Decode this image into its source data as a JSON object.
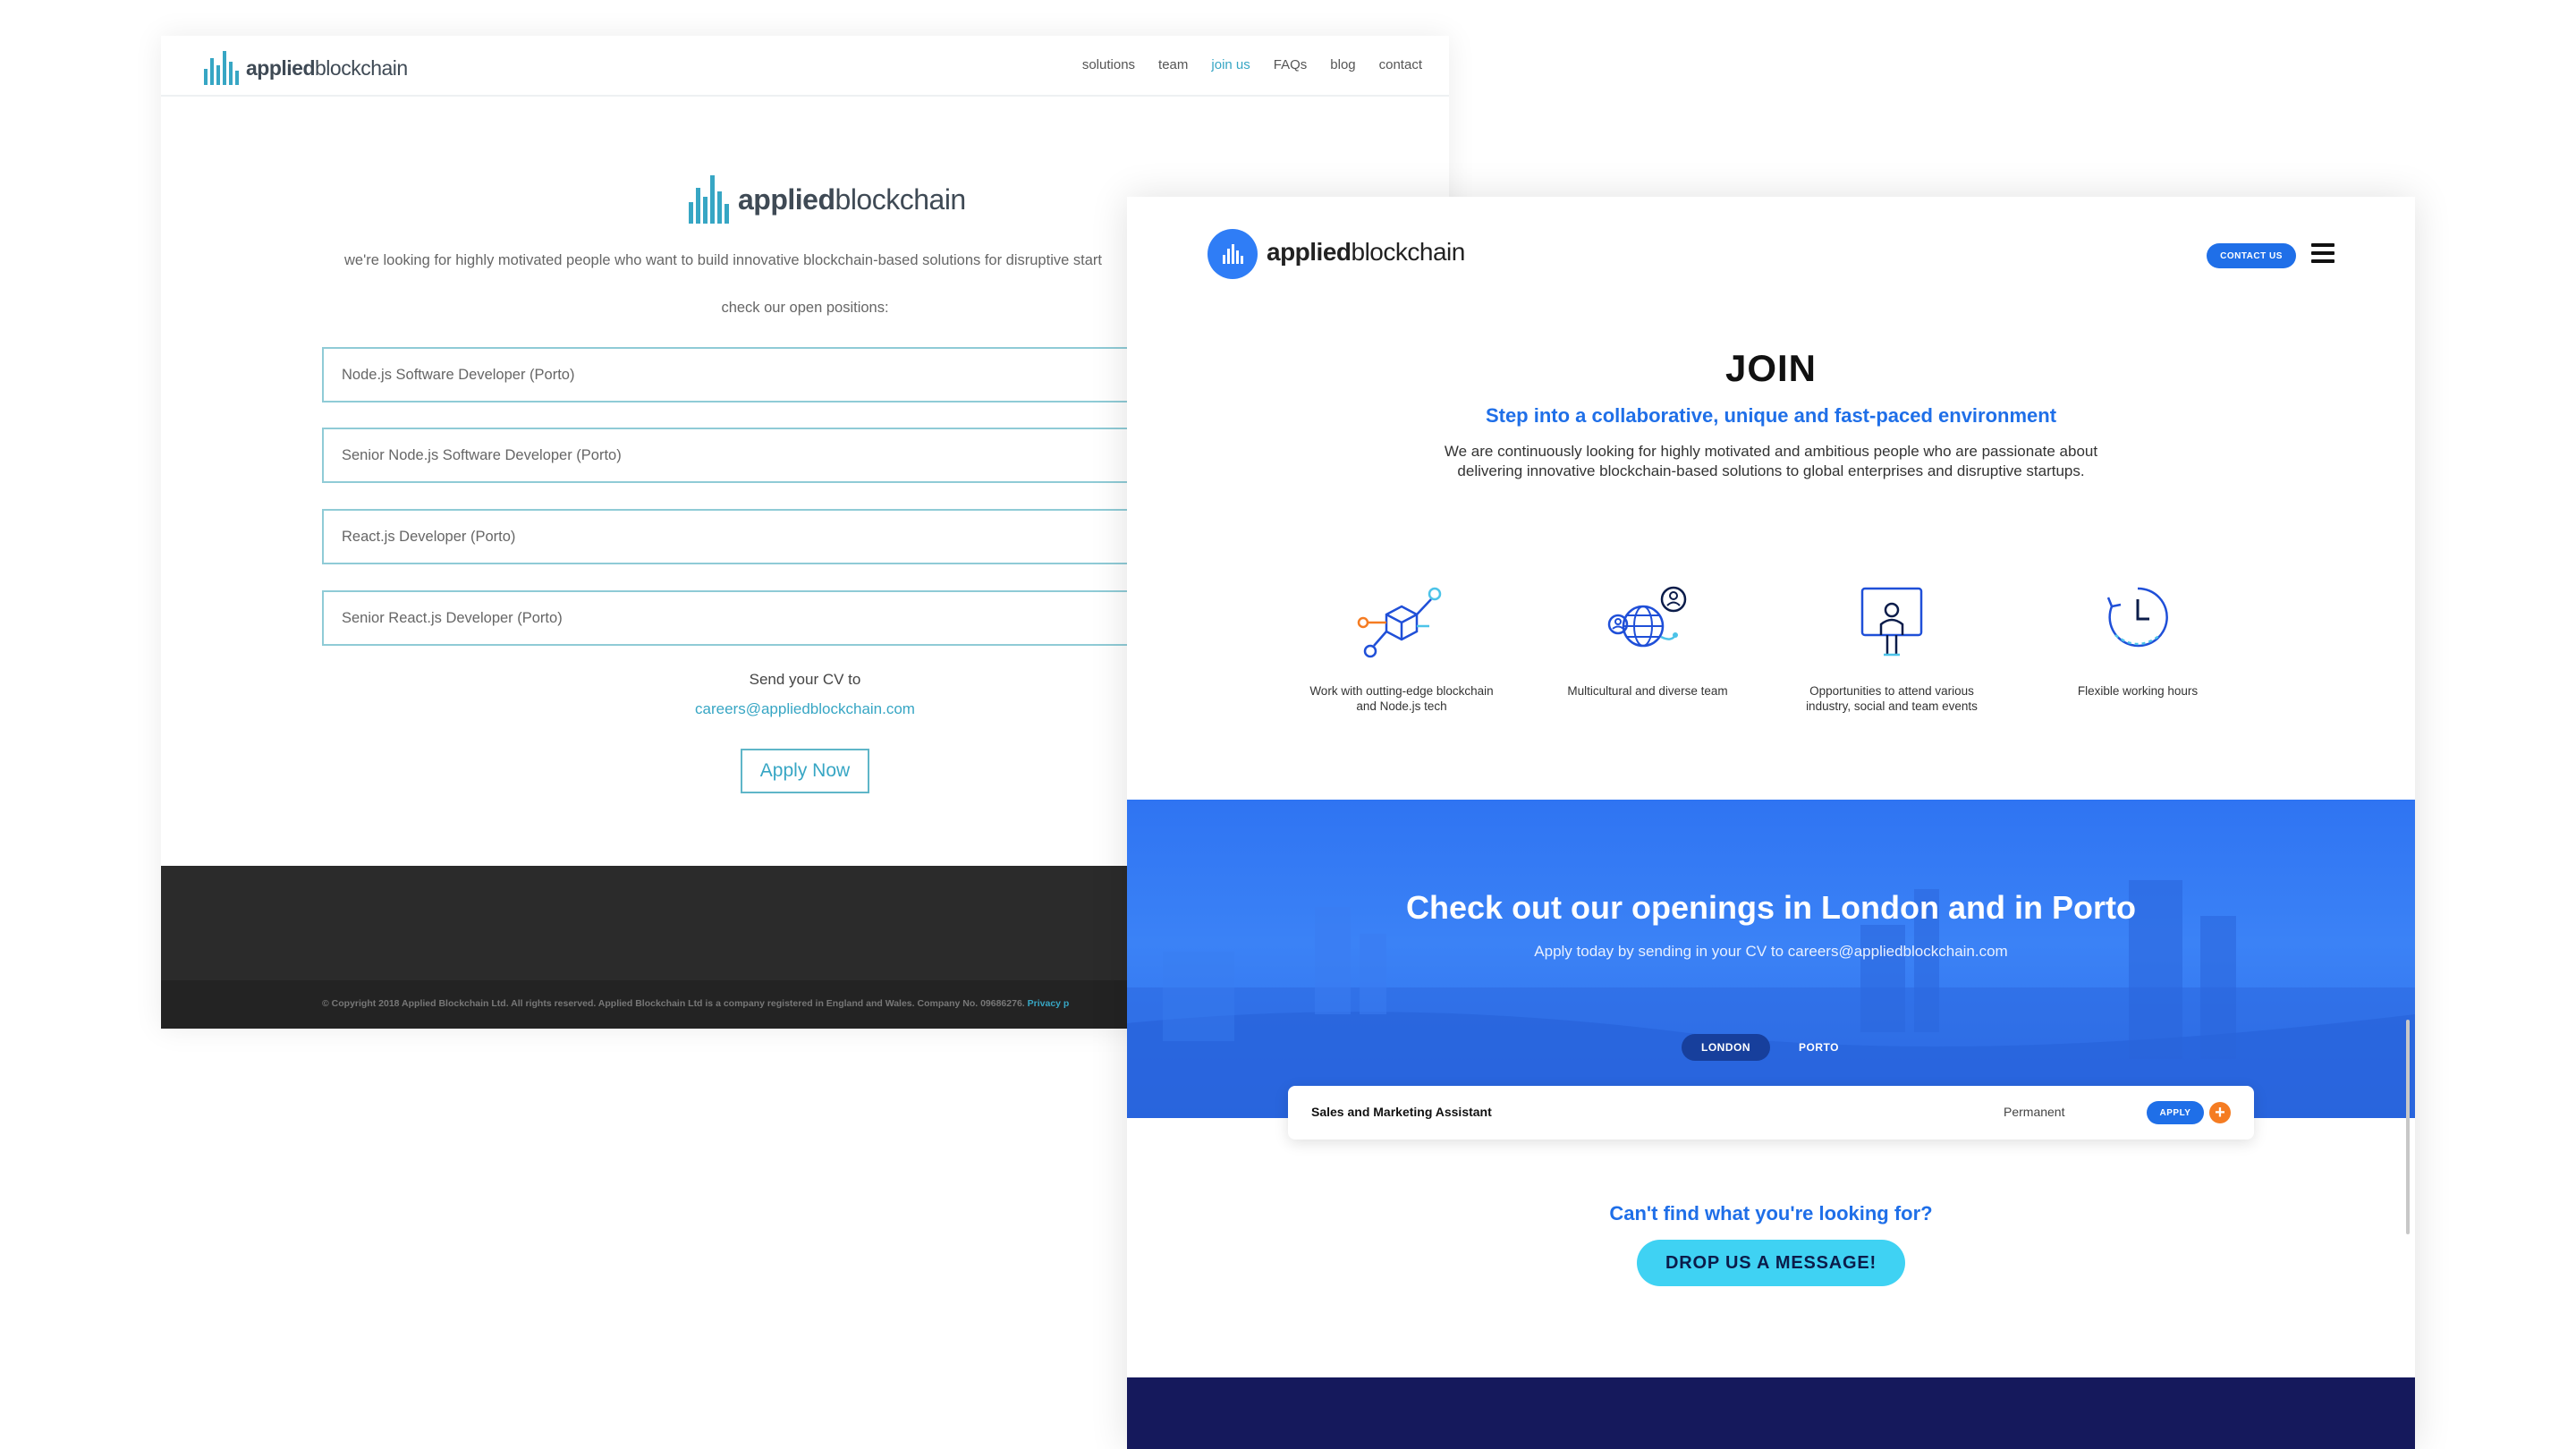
{
  "old_site": {
    "logo": {
      "bold": "applied",
      "light": "blockchain"
    },
    "nav": [
      {
        "label": "solutions",
        "active": false
      },
      {
        "label": "team",
        "active": false
      },
      {
        "label": "join us",
        "active": true
      },
      {
        "label": "FAQs",
        "active": false
      },
      {
        "label": "blog",
        "active": false
      },
      {
        "label": "contact",
        "active": false
      }
    ],
    "intro": "we're looking for highly motivated people who want to build innovative blockchain-based solutions for disruptive start",
    "check_positions": "check our open positions:",
    "positions": [
      "Node.js Software Developer (Porto)",
      "Senior Node.js Software Developer (Porto)",
      "React.js Developer (Porto)",
      "Senior React.js Developer (Porto)"
    ],
    "send_cv": "Send your CV to",
    "email": "careers@appliedblockchain.com",
    "apply_button": "Apply Now",
    "footer_copy": "© Copyright 2018 Applied Blockchain Ltd. All rights reserved. Applied Blockchain Ltd is a company registered in England and Wales. Company No. 09686276.",
    "footer_privacy": "Privacy p"
  },
  "new_site": {
    "logo": {
      "bold": "applied",
      "light": "blockchain"
    },
    "contact_button": "CONTACT US",
    "title": "JOIN",
    "subtitle": "Step into a collaborative, unique and fast-paced environment",
    "description_line1": "We are continuously looking for highly motivated and ambitious people who are passionate about",
    "description_line2": "delivering innovative blockchain-based solutions to global enterprises and disruptive startups.",
    "features": [
      {
        "icon": "blockchain-cube-icon",
        "line1": "Work with outting-edge blockchain",
        "line2": "and Node.js tech"
      },
      {
        "icon": "globe-team-icon",
        "line1": "Multicultural and diverse team",
        "line2": ""
      },
      {
        "icon": "presentation-icon",
        "line1": "Opportunities to attend various",
        "line2": "industry, social and team events"
      },
      {
        "icon": "clock-icon",
        "line1": "Flexible working hours",
        "line2": ""
      }
    ],
    "openings_title": "Check out our openings in London and in Porto",
    "openings_sub": "Apply today by sending in your CV to careers@appliedblockchain.com",
    "tabs": [
      {
        "label": "LONDON",
        "active": true
      },
      {
        "label": "PORTO",
        "active": false
      }
    ],
    "job": {
      "title": "Sales and Marketing Assistant",
      "type": "Permanent",
      "apply": "APPLY",
      "expand": "+"
    },
    "cant_find": "Can't find what you're looking for?",
    "drop_button": "DROP US A MESSAGE!",
    "colors": {
      "primary": "#1f6fe8",
      "accent": "#3fd2f3",
      "orange": "#f57c22",
      "navy": "#15195c"
    }
  }
}
